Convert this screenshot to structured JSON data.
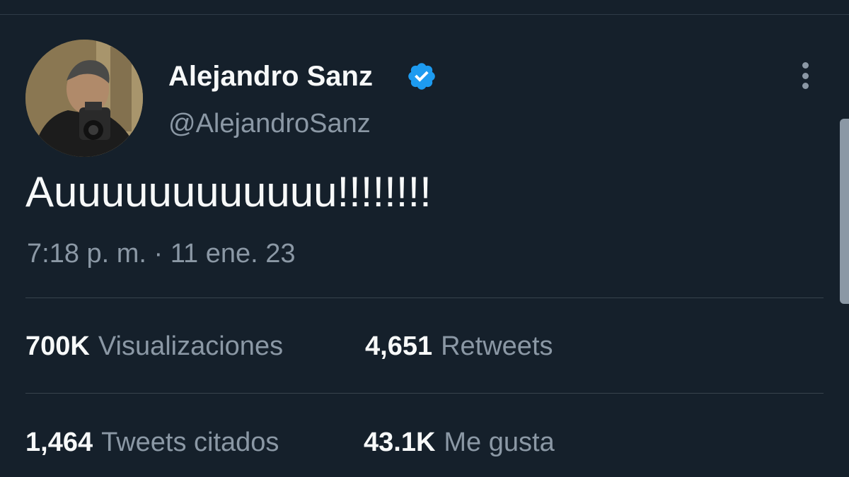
{
  "user": {
    "display_name": "Alejandro Sanz",
    "handle": "@AlejandroSanz",
    "verified": true,
    "avatar": "profile-photo-man-with-camera"
  },
  "tweet": {
    "text": "Auuuuuuuuuuuu!!!!!!!!",
    "timestamp": "7:18 p. m. · 11 ene. 23"
  },
  "stats": {
    "views": {
      "value": "700K",
      "label": "Visualizaciones"
    },
    "retweets": {
      "value": "4,651",
      "label": "Retweets"
    },
    "quotes": {
      "value": "1,464",
      "label": "Tweets citados"
    },
    "likes": {
      "value": "43.1K",
      "label": "Me gusta"
    }
  },
  "icons": {
    "verified": "verified-badge-icon",
    "more": "more-options-icon"
  },
  "colors": {
    "background": "#15202b",
    "primary_text": "#f7f9f9",
    "secondary_text": "#8b98a5",
    "verified": "#1d9bf0",
    "divider": "#38444d"
  }
}
